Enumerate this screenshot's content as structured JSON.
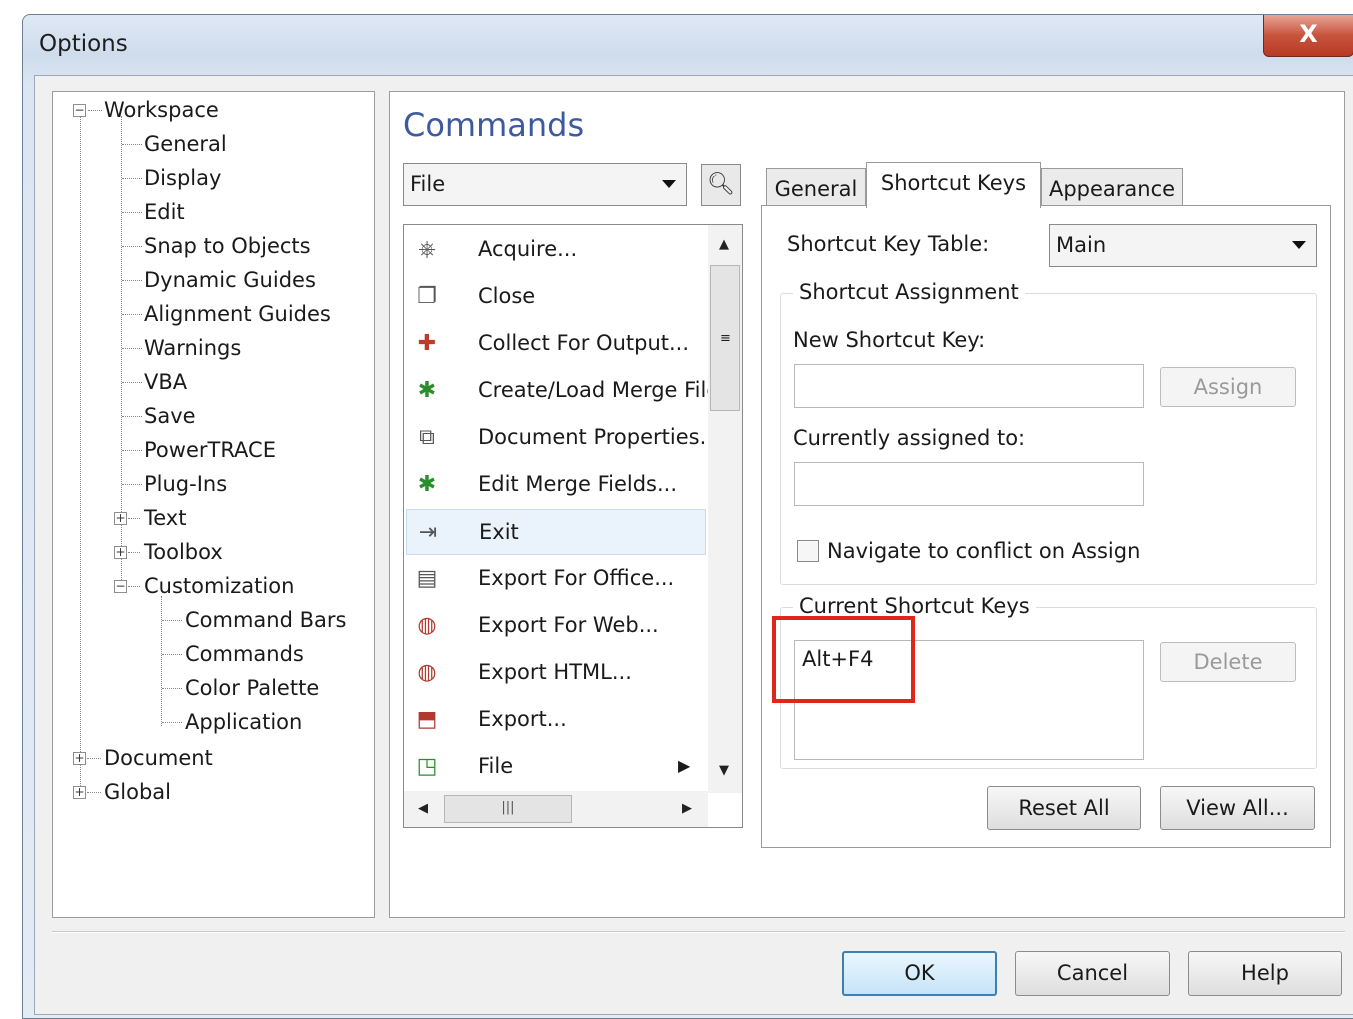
{
  "window": {
    "title": "Options",
    "close_glyph": "X"
  },
  "tree": {
    "workspace": "Workspace",
    "general": "General",
    "display": "Display",
    "edit": "Edit",
    "snap": "Snap to Objects",
    "dynamic": "Dynamic Guides",
    "alignment": "Alignment Guides",
    "warnings": "Warnings",
    "vba": "VBA",
    "save": "Save",
    "powertrace": "PowerTRACE",
    "plugins": "Plug-Ins",
    "text": "Text",
    "toolbox": "Toolbox",
    "customization": "Customization",
    "command_bars": "Command Bars",
    "commands": "Commands",
    "color_palette": "Color Palette",
    "application": "Application",
    "document": "Document",
    "global": "Global"
  },
  "main": {
    "heading": "Commands",
    "category": "File",
    "commands": [
      {
        "label": "Acquire...",
        "icon": "acquire-icon"
      },
      {
        "label": "Close",
        "icon": "close-file-icon"
      },
      {
        "label": "Collect For Output...",
        "icon": "collect-output-icon"
      },
      {
        "label": "Create/Load Merge File",
        "icon": "merge-file-icon"
      },
      {
        "label": "Document Properties...",
        "icon": "document-properties-icon"
      },
      {
        "label": "Edit Merge Fields...",
        "icon": "edit-merge-icon"
      },
      {
        "label": "Exit",
        "icon": "exit-icon"
      },
      {
        "label": "Export For Office...",
        "icon": "export-office-icon"
      },
      {
        "label": "Export For Web...",
        "icon": "export-web-icon"
      },
      {
        "label": "Export HTML...",
        "icon": "export-html-icon"
      },
      {
        "label": "Export...",
        "icon": "export-icon"
      },
      {
        "label": "File",
        "icon": "file-icon"
      }
    ],
    "selected_command": "Exit"
  },
  "tabs": {
    "general": "General",
    "shortcut_keys": "Shortcut Keys",
    "appearance": "Appearance",
    "active": "Shortcut Keys"
  },
  "shortcut": {
    "table_label": "Shortcut Key Table:",
    "table_value": "Main",
    "assignment_group": "Shortcut Assignment",
    "new_key_label": "New Shortcut Key:",
    "new_key_value": "",
    "assign_button": "Assign",
    "assigned_to_label": "Currently assigned to:",
    "assigned_to_value": "",
    "navigate_label": "Navigate to conflict on Assign",
    "navigate_checked": false,
    "current_group": "Current Shortcut Keys",
    "current_keys": [
      "Alt+F4"
    ],
    "delete_button": "Delete",
    "reset_button": "Reset All",
    "view_button": "View All..."
  },
  "footer": {
    "ok": "OK",
    "cancel": "Cancel",
    "help": "Help"
  },
  "colors": {
    "heading": "#3d5a9e",
    "highlight": "#e0261b",
    "close": "#c7533d"
  }
}
